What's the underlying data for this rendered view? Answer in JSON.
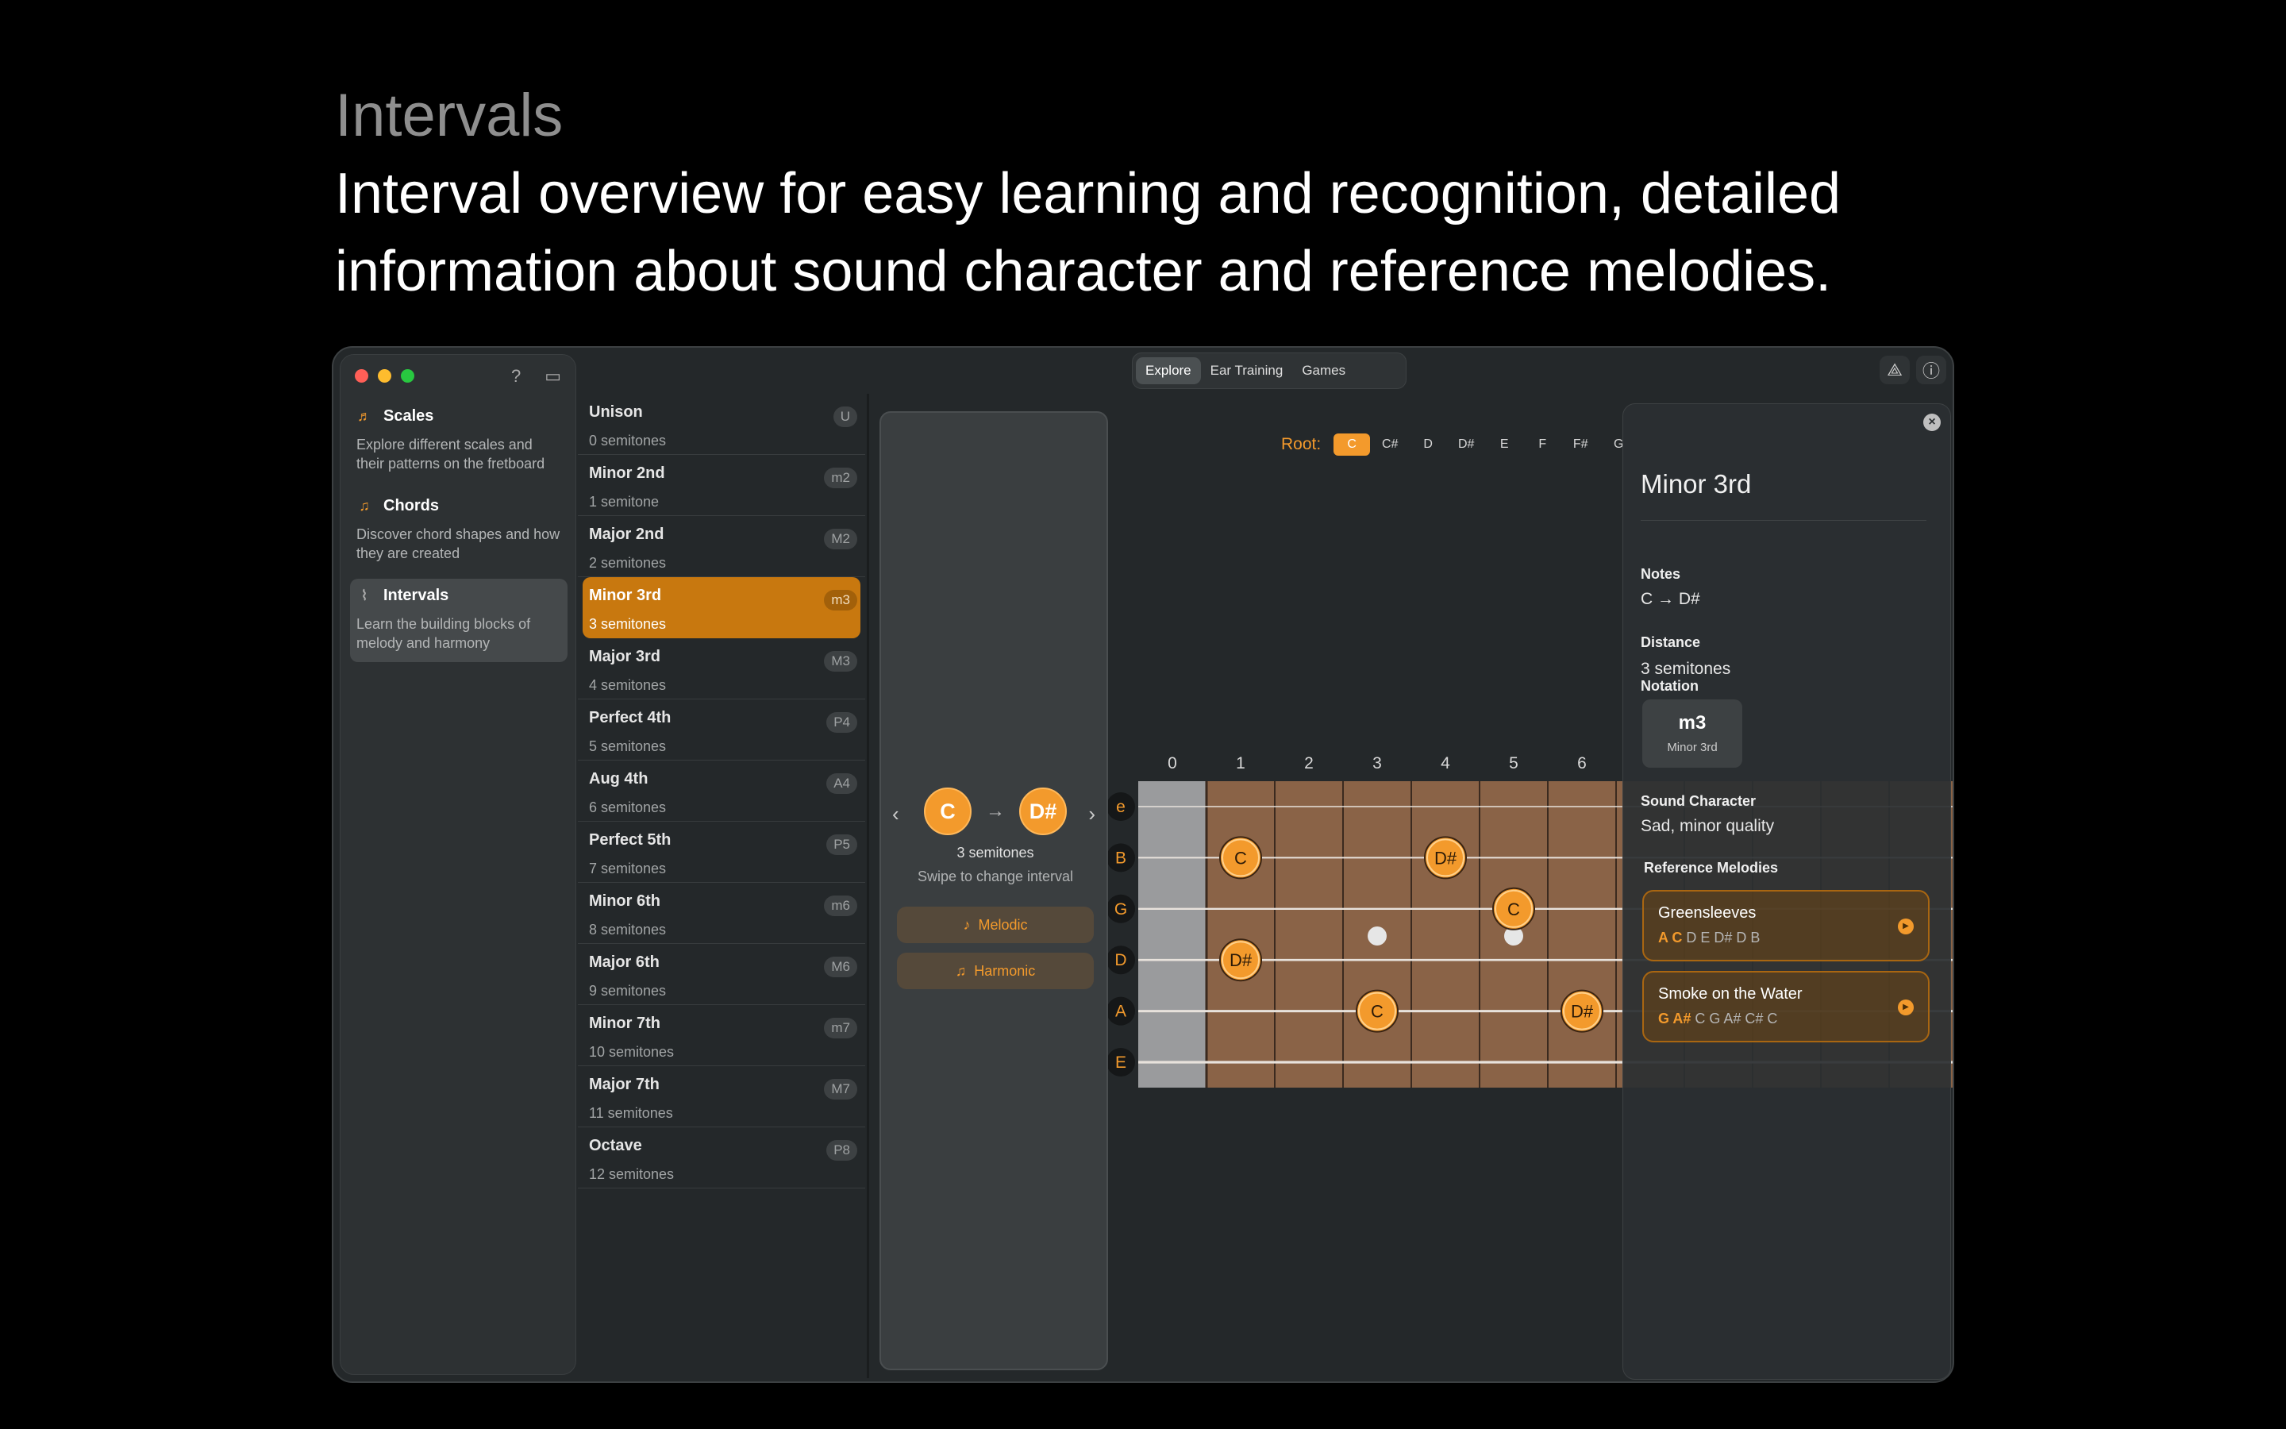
{
  "hero": {
    "kicker": "Intervals",
    "headline_line1": "Interval overview for easy learning and recognition, detailed",
    "headline_line2": "information about sound character and reference melodies."
  },
  "colors": {
    "accent": "#f39a2c",
    "close": "#ff5f57",
    "minimize": "#febc2e",
    "zoom": "#28c840"
  },
  "sidebar": {
    "icons": [
      "help-icon",
      "sidebar-toggle-icon"
    ],
    "items": [
      {
        "title": "Scales",
        "desc": "Explore different scales and their patterns on the fretboard",
        "icon": "scales-icon"
      },
      {
        "title": "Chords",
        "desc": "Discover chord shapes and how they are created",
        "icon": "chords-icon"
      },
      {
        "title": "Intervals",
        "desc": "Learn the building blocks of melody and harmony",
        "icon": "intervals-icon"
      }
    ]
  },
  "toolbar": {
    "tabs": [
      "Explore",
      "Ear Training",
      "Games"
    ],
    "active_tab": "Explore"
  },
  "intervals": [
    {
      "name": "Unison",
      "semitones": "0 semitones",
      "abbr": "U"
    },
    {
      "name": "Minor 2nd",
      "semitones": "1 semitone",
      "abbr": "m2"
    },
    {
      "name": "Major 2nd",
      "semitones": "2 semitones",
      "abbr": "M2"
    },
    {
      "name": "Minor 3rd",
      "semitones": "3 semitones",
      "abbr": "m3"
    },
    {
      "name": "Major 3rd",
      "semitones": "4 semitones",
      "abbr": "M3"
    },
    {
      "name": "Perfect 4th",
      "semitones": "5 semitones",
      "abbr": "P4"
    },
    {
      "name": "Aug 4th",
      "semitones": "6 semitones",
      "abbr": "A4"
    },
    {
      "name": "Perfect 5th",
      "semitones": "7 semitones",
      "abbr": "P5"
    },
    {
      "name": "Minor 6th",
      "semitones": "8 semitones",
      "abbr": "m6"
    },
    {
      "name": "Major 6th",
      "semitones": "9 semitones",
      "abbr": "M6"
    },
    {
      "name": "Minor 7th",
      "semitones": "10 semitones",
      "abbr": "m7"
    },
    {
      "name": "Major 7th",
      "semitones": "11 semitones",
      "abbr": "M7"
    },
    {
      "name": "Octave",
      "semitones": "12 semitones",
      "abbr": "P8"
    }
  ],
  "selected_interval": "Minor 3rd",
  "interval_card": {
    "note_from": "C",
    "arrow": "→",
    "note_to": "D#",
    "semitones": "3 semitones",
    "hint": "Swipe to change interval",
    "melodic_label": "Melodic",
    "harmonic_label": "Harmonic"
  },
  "root": {
    "label": "Root:",
    "keys": [
      "C",
      "C#",
      "D",
      "D#",
      "E",
      "F",
      "F#",
      "G"
    ],
    "selected": "C"
  },
  "fretboard": {
    "frets": [
      "0",
      "1",
      "2",
      "3",
      "4",
      "5",
      "6"
    ],
    "strings": [
      "e",
      "B",
      "G",
      "D",
      "A",
      "E"
    ],
    "notes": [
      {
        "string": "B",
        "fret": 1,
        "label": "C"
      },
      {
        "string": "B",
        "fret": 4,
        "label": "D#"
      },
      {
        "string": "G",
        "fret": 5,
        "label": "C"
      },
      {
        "string": "D",
        "fret": 1,
        "label": "D#"
      },
      {
        "string": "A",
        "fret": 3,
        "label": "C"
      },
      {
        "string": "A",
        "fret": 6,
        "label": "D#"
      }
    ]
  },
  "detail": {
    "title": "Minor 3rd",
    "notes_label": "Notes",
    "notes_value": "C → D#",
    "distance_label": "Distance",
    "distance_value": "3 semitones",
    "notation_label": "Notation",
    "notation_abbr": "m3",
    "notation_name": "Minor 3rd",
    "character_label": "Sound Character",
    "character_value": "Sad, minor quality",
    "melodies_label": "Reference Melodies",
    "melodies": [
      {
        "name": "Greensleeves",
        "highlight": "A C",
        "rest": "D E D# D B"
      },
      {
        "name": "Smoke on the Water",
        "highlight": "G A#",
        "rest": "C G A# C# C"
      }
    ]
  }
}
